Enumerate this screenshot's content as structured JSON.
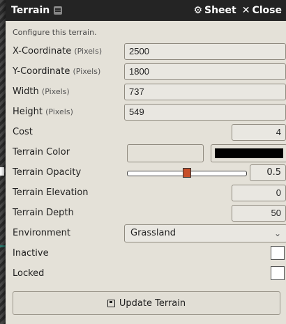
{
  "window": {
    "title": "Terrain",
    "sheet_label": "Sheet",
    "close_label": "Close"
  },
  "hint": "Configure this terrain.",
  "fields": {
    "x": {
      "label": "X-Coordinate",
      "sub": "(Pixels)",
      "value": "2500"
    },
    "y": {
      "label": "Y-Coordinate",
      "sub": "(Pixels)",
      "value": "1800"
    },
    "width": {
      "label": "Width",
      "sub": "(Pixels)",
      "value": "737"
    },
    "height": {
      "label": "Height",
      "sub": "(Pixels)",
      "value": "549"
    },
    "cost": {
      "label": "Cost",
      "value": "4"
    },
    "color": {
      "label": "Terrain Color",
      "value": "#000000"
    },
    "opacity": {
      "label": "Terrain Opacity",
      "value": "0.5"
    },
    "elevation": {
      "label": "Terrain Elevation",
      "value": "0"
    },
    "depth": {
      "label": "Terrain Depth",
      "value": "50"
    },
    "environment": {
      "label": "Environment",
      "value": "Grassland"
    },
    "inactive": {
      "label": "Inactive",
      "checked": false
    },
    "locked": {
      "label": "Locked",
      "checked": false
    }
  },
  "update_label": "Update Terrain",
  "icons": {
    "window": "tag-icon",
    "sheet": "gear-icon",
    "close": "close-icon",
    "update": "save-icon",
    "select": "chevron-down-icon"
  },
  "colors": {
    "titlebar": "#242424",
    "panel": "#e4e1d8",
    "slider_handle": "#c64f2a"
  }
}
